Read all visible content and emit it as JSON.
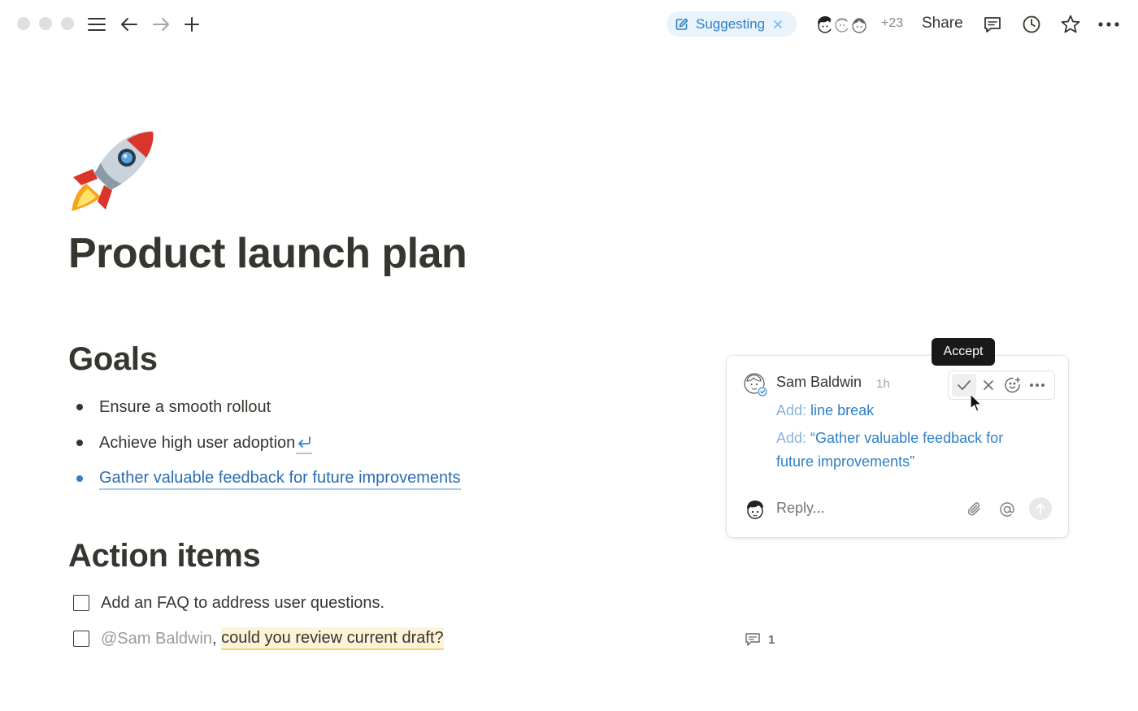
{
  "topbar": {
    "mode_label": "Suggesting",
    "collaborator_overflow": "+23",
    "share_label": "Share"
  },
  "document": {
    "title": "Product launch plan",
    "sections": {
      "goals": {
        "heading": "Goals",
        "bullets": [
          "Ensure a smooth rollout",
          "Achieve high user adoption",
          "Gather valuable feedback for future improvements"
        ]
      },
      "action_items": {
        "heading": "Action items",
        "todos": [
          "Add an FAQ to address user questions.",
          {
            "mention": "@Sam Baldwin",
            "separator": ", ",
            "text": "could you review current draft?"
          }
        ]
      }
    },
    "comment_count": "1"
  },
  "comment_card": {
    "tooltip": "Accept",
    "author": "Sam Baldwin",
    "time": "1h",
    "changes": [
      {
        "keyword": "Add:",
        "content": "line break"
      },
      {
        "keyword": "Add:",
        "content": "“Gather valuable feedback for future improvements”"
      }
    ],
    "reply_placeholder": "Reply..."
  },
  "colors": {
    "text": "#37352f",
    "suggestion_blue": "#2f80c8",
    "suggest_pill_bg": "#e9f3fb",
    "highlight_bg": "#fdf4d7",
    "tooltip_bg": "#191919"
  },
  "icons": [
    "sidebar-toggle-icon",
    "back-arrow-icon",
    "forward-arrow-icon",
    "plus-icon",
    "suggest-edit-icon",
    "close-icon",
    "comments-icon",
    "history-clock-icon",
    "star-icon",
    "more-dots-icon",
    "rocket-icon",
    "line-break-icon",
    "checkmark-icon",
    "reject-x-icon",
    "add-reaction-icon",
    "attach-icon",
    "at-mention-icon",
    "send-arrow-icon",
    "comment-bubble-icon"
  ]
}
